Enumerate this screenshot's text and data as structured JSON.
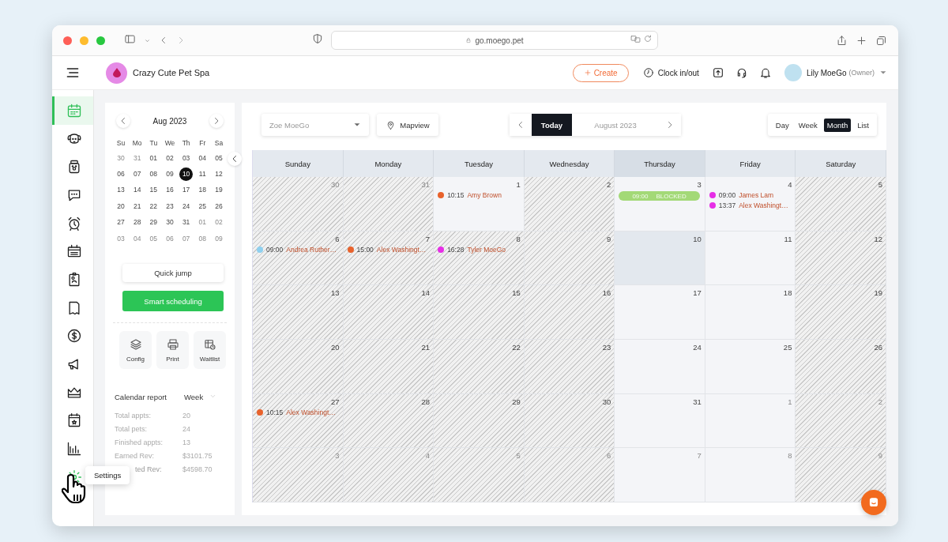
{
  "browser": {
    "url": "go.moego.pet"
  },
  "header": {
    "business": "Crazy Cute Pet Spa",
    "create": "Create",
    "clock": "Clock in/out",
    "user": "Lily MoeGo",
    "role": "(Owner)"
  },
  "sidebar": {
    "items": [
      {
        "kind": "calendar",
        "selected": true
      },
      {
        "kind": "dog",
        "selected": false
      },
      {
        "kind": "jar",
        "selected": false
      },
      {
        "kind": "chat",
        "selected": false
      },
      {
        "kind": "alarm",
        "selected": false
      },
      {
        "kind": "schedule",
        "selected": false
      },
      {
        "kind": "badge",
        "selected": false
      },
      {
        "kind": "document",
        "selected": false
      },
      {
        "kind": "dollar",
        "selected": false
      },
      {
        "kind": "megaphone",
        "selected": false
      },
      {
        "kind": "crown",
        "selected": false
      },
      {
        "kind": "event",
        "selected": false
      },
      {
        "kind": "chart",
        "selected": false
      },
      {
        "kind": "settings",
        "selected": false
      }
    ],
    "tooltip": "Settings"
  },
  "mini_calendar": {
    "title": "Aug 2023",
    "weekdays": [
      "Su",
      "Mo",
      "Tu",
      "We",
      "Th",
      "Fr",
      "Sa"
    ],
    "days": [
      {
        "label": "30",
        "muted": true,
        "selected": false
      },
      {
        "label": "31",
        "muted": true,
        "selected": false
      },
      {
        "label": "01",
        "muted": false,
        "selected": false
      },
      {
        "label": "02",
        "muted": false,
        "selected": false
      },
      {
        "label": "03",
        "muted": false,
        "selected": false
      },
      {
        "label": "04",
        "muted": false,
        "selected": false
      },
      {
        "label": "05",
        "muted": false,
        "selected": false
      },
      {
        "label": "06",
        "muted": false,
        "selected": false
      },
      {
        "label": "07",
        "muted": false,
        "selected": false
      },
      {
        "label": "08",
        "muted": false,
        "selected": false
      },
      {
        "label": "09",
        "muted": false,
        "selected": false
      },
      {
        "label": "10",
        "muted": false,
        "selected": true
      },
      {
        "label": "11",
        "muted": false,
        "selected": false
      },
      {
        "label": "12",
        "muted": false,
        "selected": false
      },
      {
        "label": "13",
        "muted": false,
        "selected": false
      },
      {
        "label": "14",
        "muted": false,
        "selected": false
      },
      {
        "label": "15",
        "muted": false,
        "selected": false
      },
      {
        "label": "16",
        "muted": false,
        "selected": false
      },
      {
        "label": "17",
        "muted": false,
        "selected": false
      },
      {
        "label": "18",
        "muted": false,
        "selected": false
      },
      {
        "label": "19",
        "muted": false,
        "selected": false
      },
      {
        "label": "20",
        "muted": false,
        "selected": false
      },
      {
        "label": "21",
        "muted": false,
        "selected": false
      },
      {
        "label": "22",
        "muted": false,
        "selected": false
      },
      {
        "label": "23",
        "muted": false,
        "selected": false
      },
      {
        "label": "24",
        "muted": false,
        "selected": false
      },
      {
        "label": "25",
        "muted": false,
        "selected": false
      },
      {
        "label": "26",
        "muted": false,
        "selected": false
      },
      {
        "label": "27",
        "muted": false,
        "selected": false
      },
      {
        "label": "28",
        "muted": false,
        "selected": false
      },
      {
        "label": "29",
        "muted": false,
        "selected": false
      },
      {
        "label": "30",
        "muted": false,
        "selected": false
      },
      {
        "label": "31",
        "muted": false,
        "selected": false
      },
      {
        "label": "01",
        "muted": true,
        "selected": false
      },
      {
        "label": "02",
        "muted": true,
        "selected": false
      },
      {
        "label": "03",
        "muted": true,
        "selected": false
      },
      {
        "label": "04",
        "muted": true,
        "selected": false
      },
      {
        "label": "05",
        "muted": true,
        "selected": false
      },
      {
        "label": "06",
        "muted": true,
        "selected": false
      },
      {
        "label": "07",
        "muted": true,
        "selected": false
      },
      {
        "label": "08",
        "muted": true,
        "selected": false
      },
      {
        "label": "09",
        "muted": true,
        "selected": false
      }
    ]
  },
  "actions": {
    "quick_jump": "Quick jump",
    "smart": "Smart scheduling"
  },
  "tools": [
    {
      "kind": "config",
      "label": "Config"
    },
    {
      "kind": "print",
      "label": "Print"
    },
    {
      "kind": "waitlist",
      "label": "Waitlist"
    }
  ],
  "report": {
    "title": "Calendar report",
    "period": "Week",
    "rows": [
      {
        "label": "Total appts:",
        "value": "20"
      },
      {
        "label": "Total pets:",
        "value": "24"
      },
      {
        "label": "Finished appts:",
        "value": "13"
      },
      {
        "label": "Earned Rev:",
        "value": "$3101.75"
      },
      {
        "label": "ted Rev:",
        "value": "$4598.70"
      }
    ]
  },
  "toolbar": {
    "staff": "Zoe MoeGo",
    "mapview": "Mapview",
    "today": "Today",
    "month": "August 2023",
    "views": [
      {
        "label": "Day",
        "selected": false
      },
      {
        "label": "Week",
        "selected": false
      },
      {
        "label": "Month",
        "selected": true
      },
      {
        "label": "List",
        "selected": false
      }
    ]
  },
  "calendar": {
    "columns": [
      {
        "label": "Sunday",
        "selected": false
      },
      {
        "label": "Monday",
        "selected": false
      },
      {
        "label": "Tuesday",
        "selected": false
      },
      {
        "label": "Wednesday",
        "selected": false
      },
      {
        "label": "Thursday",
        "selected": true
      },
      {
        "label": "Friday",
        "selected": false
      },
      {
        "label": "Saturday",
        "selected": false
      }
    ],
    "weeks": [
      [
        {
          "day": "30",
          "muted": true,
          "closed": true,
          "today": false
        },
        {
          "day": "31",
          "muted": true,
          "closed": true,
          "today": false
        },
        {
          "day": "1",
          "muted": false,
          "closed": false,
          "today": false,
          "events": [
            {
              "kind": "appointment",
              "color": "#e8622c",
              "time": "10:15",
              "name": "Amy Brown"
            }
          ]
        },
        {
          "day": "2",
          "muted": false,
          "closed": true,
          "today": false
        },
        {
          "day": "3",
          "muted": false,
          "closed": false,
          "today": false,
          "events": [
            {
              "kind": "blocked",
              "color": "#a3d977",
              "time": "09:00",
              "name": "BLOCKED"
            }
          ]
        },
        {
          "day": "4",
          "muted": false,
          "closed": false,
          "today": false,
          "events": [
            {
              "kind": "appointment",
              "color": "#e62ee6",
              "time": "09:00",
              "name": "James Lam"
            },
            {
              "kind": "appointment",
              "color": "#e62ee6",
              "time": "13:37",
              "name": "Alex Washingt…"
            }
          ]
        },
        {
          "day": "5",
          "muted": false,
          "closed": true,
          "today": false
        }
      ],
      [
        {
          "day": "6",
          "muted": false,
          "closed": true,
          "today": false,
          "events": [
            {
              "kind": "appointment",
              "color": "#8fd0ef",
              "time": "09:00",
              "name": "Andrea Ruther…"
            }
          ]
        },
        {
          "day": "7",
          "muted": false,
          "closed": true,
          "today": false,
          "events": [
            {
              "kind": "appointment",
              "color": "#e8622c",
              "time": "15:00",
              "name": "Alex Washingt…"
            }
          ]
        },
        {
          "day": "8",
          "muted": false,
          "closed": true,
          "today": false,
          "events": [
            {
              "kind": "appointment",
              "color": "#e62ee6",
              "time": "16:28",
              "name": "Tyler MoeGo"
            }
          ]
        },
        {
          "day": "9",
          "muted": false,
          "closed": true,
          "today": false
        },
        {
          "day": "10",
          "muted": false,
          "closed": false,
          "today": true
        },
        {
          "day": "11",
          "muted": false,
          "closed": false,
          "today": false
        },
        {
          "day": "12",
          "muted": false,
          "closed": true,
          "today": false
        }
      ],
      [
        {
          "day": "13",
          "muted": false,
          "closed": true,
          "today": false
        },
        {
          "day": "14",
          "muted": false,
          "closed": true,
          "today": false
        },
        {
          "day": "15",
          "muted": false,
          "closed": true,
          "today": false
        },
        {
          "day": "16",
          "muted": false,
          "closed": true,
          "today": false
        },
        {
          "day": "17",
          "muted": false,
          "closed": false,
          "today": false
        },
        {
          "day": "18",
          "muted": false,
          "closed": false,
          "today": false
        },
        {
          "day": "19",
          "muted": false,
          "closed": true,
          "today": false
        }
      ],
      [
        {
          "day": "20",
          "muted": false,
          "closed": true,
          "today": false
        },
        {
          "day": "21",
          "muted": false,
          "closed": true,
          "today": false
        },
        {
          "day": "22",
          "muted": false,
          "closed": true,
          "today": false
        },
        {
          "day": "23",
          "muted": false,
          "closed": true,
          "today": false
        },
        {
          "day": "24",
          "muted": false,
          "closed": false,
          "today": false
        },
        {
          "day": "25",
          "muted": false,
          "closed": false,
          "today": false
        },
        {
          "day": "26",
          "muted": false,
          "closed": true,
          "today": false
        }
      ],
      [
        {
          "day": "27",
          "muted": false,
          "closed": true,
          "today": false,
          "events": [
            {
              "kind": "appointment",
              "color": "#e8622c",
              "time": "10:15",
              "name": "Alex Washingt…"
            }
          ]
        },
        {
          "day": "28",
          "muted": false,
          "closed": true,
          "today": false
        },
        {
          "day": "29",
          "muted": false,
          "closed": true,
          "today": false
        },
        {
          "day": "30",
          "muted": false,
          "closed": true,
          "today": false
        },
        {
          "day": "31",
          "muted": false,
          "closed": false,
          "today": false
        },
        {
          "day": "1",
          "muted": true,
          "closed": false,
          "today": false
        },
        {
          "day": "2",
          "muted": true,
          "closed": true,
          "today": false
        }
      ],
      [
        {
          "day": "3",
          "muted": true,
          "closed": true,
          "today": false
        },
        {
          "day": "4",
          "muted": true,
          "closed": true,
          "today": false
        },
        {
          "day": "5",
          "muted": true,
          "closed": true,
          "today": false
        },
        {
          "day": "6",
          "muted": true,
          "closed": true,
          "today": false
        },
        {
          "day": "7",
          "muted": true,
          "closed": false,
          "today": false
        },
        {
          "day": "8",
          "muted": true,
          "closed": false,
          "today": false
        },
        {
          "day": "9",
          "muted": true,
          "closed": true,
          "today": false
        }
      ]
    ]
  }
}
